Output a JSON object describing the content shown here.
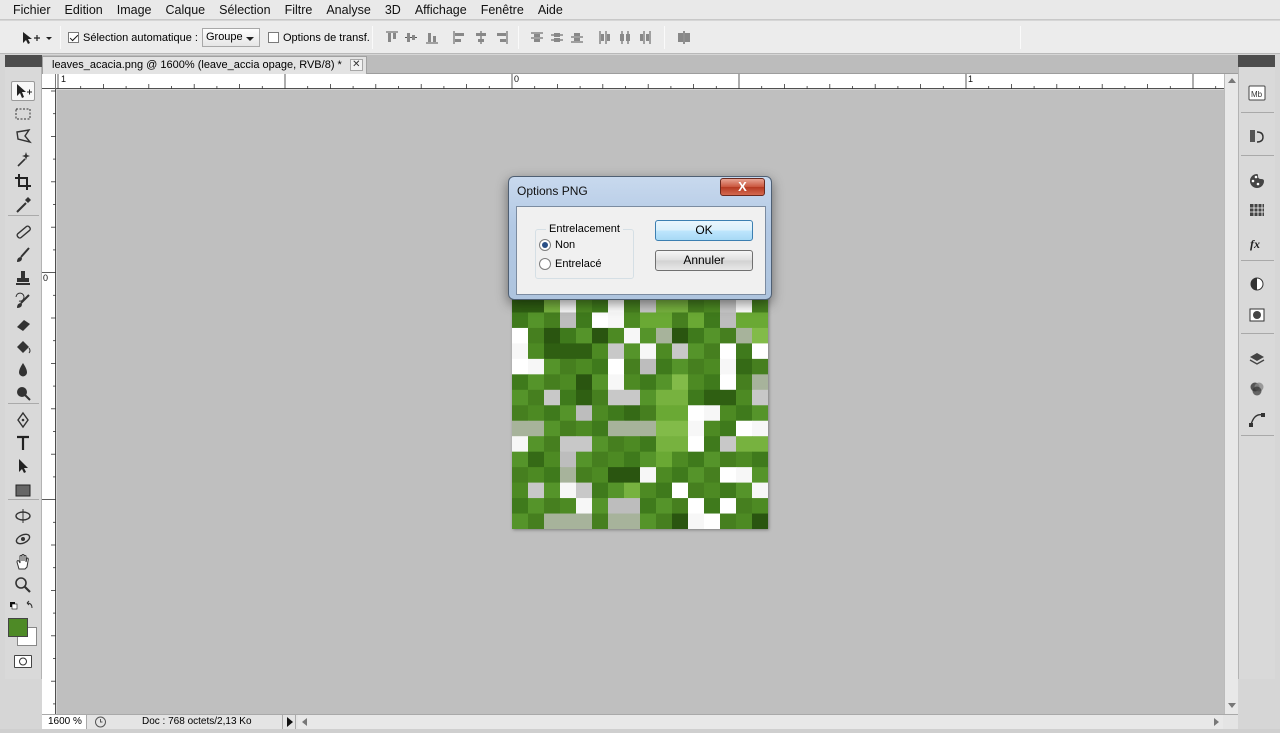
{
  "menu": [
    "Fichier",
    "Edition",
    "Image",
    "Calque",
    "Sélection",
    "Filtre",
    "Analyse",
    "3D",
    "Affichage",
    "Fenêtre",
    "Aide"
  ],
  "options_bar": {
    "auto_select_label": "Sélection automatique :",
    "auto_select_checked": true,
    "auto_select_value": "Groupe",
    "transform_label": "Options de transf.",
    "transform_checked": false
  },
  "document": {
    "tab_title": "leaves_acacia.png @ 1600% (leave_accia opage, RVB/8) *",
    "close_glyph": "✕"
  },
  "rulers": {
    "top_labels": [
      "1",
      "0",
      "1"
    ],
    "left_labels": [
      "0"
    ]
  },
  "status": {
    "zoom": "1600 %",
    "doc_info": "Doc : 768 octets/2,13 Ko"
  },
  "dialog": {
    "title": "Options PNG",
    "close_glyph": "X",
    "group_label": "Entrelacement",
    "options": [
      {
        "label": "Non",
        "selected": true
      },
      {
        "label": "Entrelacé",
        "selected": false
      }
    ],
    "ok_label": "OK",
    "cancel_label": "Annuler"
  },
  "colors": {
    "foreground": "#4e8a26",
    "background": "#ffffff",
    "dialog_close": "#c9553d"
  },
  "right_panel_icons": [
    "mini-bridge-icon",
    "history-icon",
    "color-icon",
    "swatches-icon",
    "styles-icon",
    "adjustments-icon",
    "masks-icon",
    "layers-icon",
    "channels-icon",
    "paths-icon"
  ],
  "tool_icons": [
    "move-tool-icon",
    "marquee-tool-icon",
    "lasso-tool-icon",
    "magic-wand-tool-icon",
    "crop-tool-icon",
    "eyedropper-tool-icon",
    "healing-brush-icon",
    "brush-tool-icon",
    "clone-stamp-icon",
    "history-brush-icon",
    "eraser-tool-icon",
    "paint-bucket-icon",
    "blur-tool-icon",
    "dodge-tool-icon",
    "pen-tool-icon",
    "type-tool-icon",
    "path-selection-icon",
    "rectangle-tool-icon",
    "3d-rotate-icon",
    "3d-orbit-icon",
    "hand-tool-icon",
    "zoom-tool-icon"
  ],
  "pixel_image": {
    "cols": 16,
    "rows": 15,
    "pixels": [
      "DDLWMMWMGLLMMGWM",
      "MMMGMWWMLLMLMGLL",
      "WMDMMDMWMGDMMMGL",
      "WMDDDMGMWMGMMWMW",
      "WWMMMMWMGMMMMWDM",
      "MMMMDMWMMMLMMWMG",
      "MMGMDMGGMLLMDDMG",
      "MMMMGMMDMLLWWMMM",
      "GGMMMMGGGLLWMMWW",
      "WMMGGMMMMLLWMGLL",
      "MDMGMMMMMLMMMMMM",
      "MMMGMMDDWMMMMWWM",
      "MGMWGMMLMMWMMMMW",
      "MMMMWMGGMMMWMWMM",
      "MMGGGMGGMMDWWMMD"
    ]
  }
}
